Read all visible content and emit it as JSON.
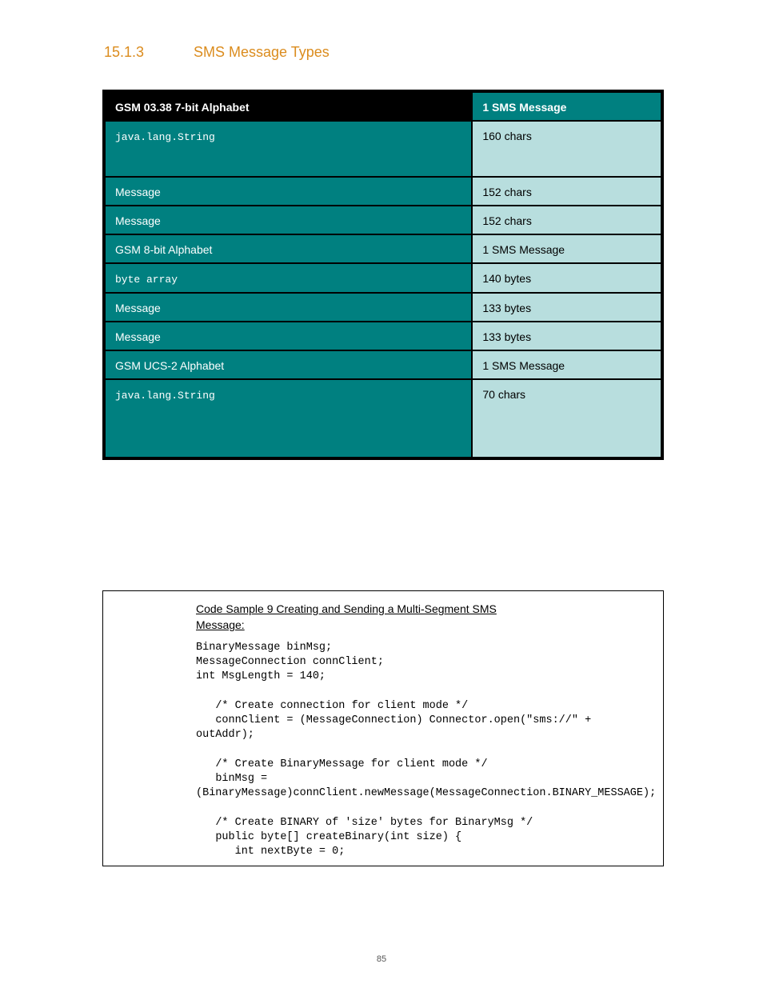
{
  "section": {
    "num": "15.1.3",
    "title": "SMS Message Types"
  },
  "table": {
    "headers": [
      "GSM 03.38 7-bit Alphabet",
      "1 SMS Message"
    ],
    "rows": [
      {
        "l": "java.lang.String",
        "r": "160 chars"
      },
      {
        "l": "Message",
        "r": "152 chars"
      },
      {
        "l": "Message",
        "r": "152 chars"
      },
      {
        "l": "GSM 8-bit Alphabet",
        "r": "1 SMS Message"
      },
      {
        "l": "byte array",
        "r": "140 bytes"
      },
      {
        "l": "Message",
        "r": "133 bytes"
      },
      {
        "l": "Message",
        "r": "133 bytes"
      },
      {
        "l": "GSM UCS-2 Alphabet",
        "r": "1 SMS Message"
      },
      {
        "l": "java.lang.String",
        "r": "70 chars"
      }
    ]
  },
  "code": {
    "title": "Code Sample 9 Creating and Sending a Multi-Segment SMS",
    "sub": "Message:",
    "body": "BinaryMessage binMsg;\nMessageConnection connClient;\nint MsgLength = 140;\n\n   /* Create connection for client mode */\n   connClient = (MessageConnection) Connector.open(\"sms://\" + outAddr);\n\n   /* Create BinaryMessage for client mode */\n   binMsg = (BinaryMessage)connClient.newMessage(MessageConnection.BINARY_MESSAGE);\n\n   /* Create BINARY of 'size' bytes for BinaryMsg */\n   public byte[] createBinary(int size) {\n      int nextByte = 0;"
  },
  "pagenum": "85"
}
